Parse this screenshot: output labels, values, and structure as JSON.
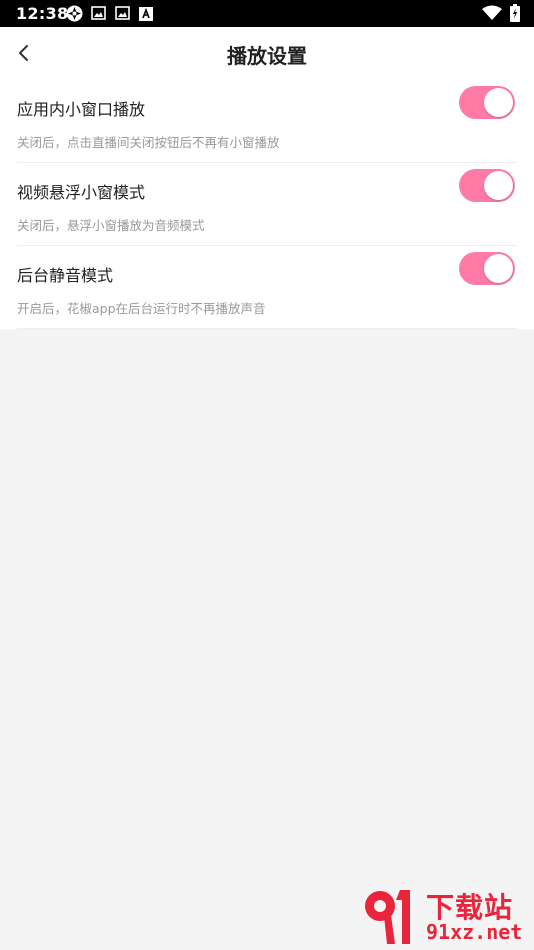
{
  "status_bar": {
    "time": "12:38",
    "left_icons": [
      "sync-icon",
      "gallery-icon",
      "gallery-icon-2",
      "a-icon"
    ],
    "right_icons": [
      "wifi-icon",
      "battery-icon"
    ]
  },
  "header": {
    "title": "播放设置"
  },
  "settings": [
    {
      "title": "应用内小窗口播放",
      "desc": "关闭后，点击直播间关闭按钮后不再有小窗播放",
      "enabled": true
    },
    {
      "title": "视频悬浮小窗模式",
      "desc": "关闭后，悬浮小窗播放为音频模式",
      "enabled": true
    },
    {
      "title": "后台静音模式",
      "desc": "开启后，花椒app在后台运行时不再播放声音",
      "enabled": true
    }
  ],
  "watermark": {
    "title": "下载站",
    "url": "91xz.net"
  },
  "colors": {
    "toggle_on": "#ff7ba6",
    "watermark": "#e8253a"
  }
}
